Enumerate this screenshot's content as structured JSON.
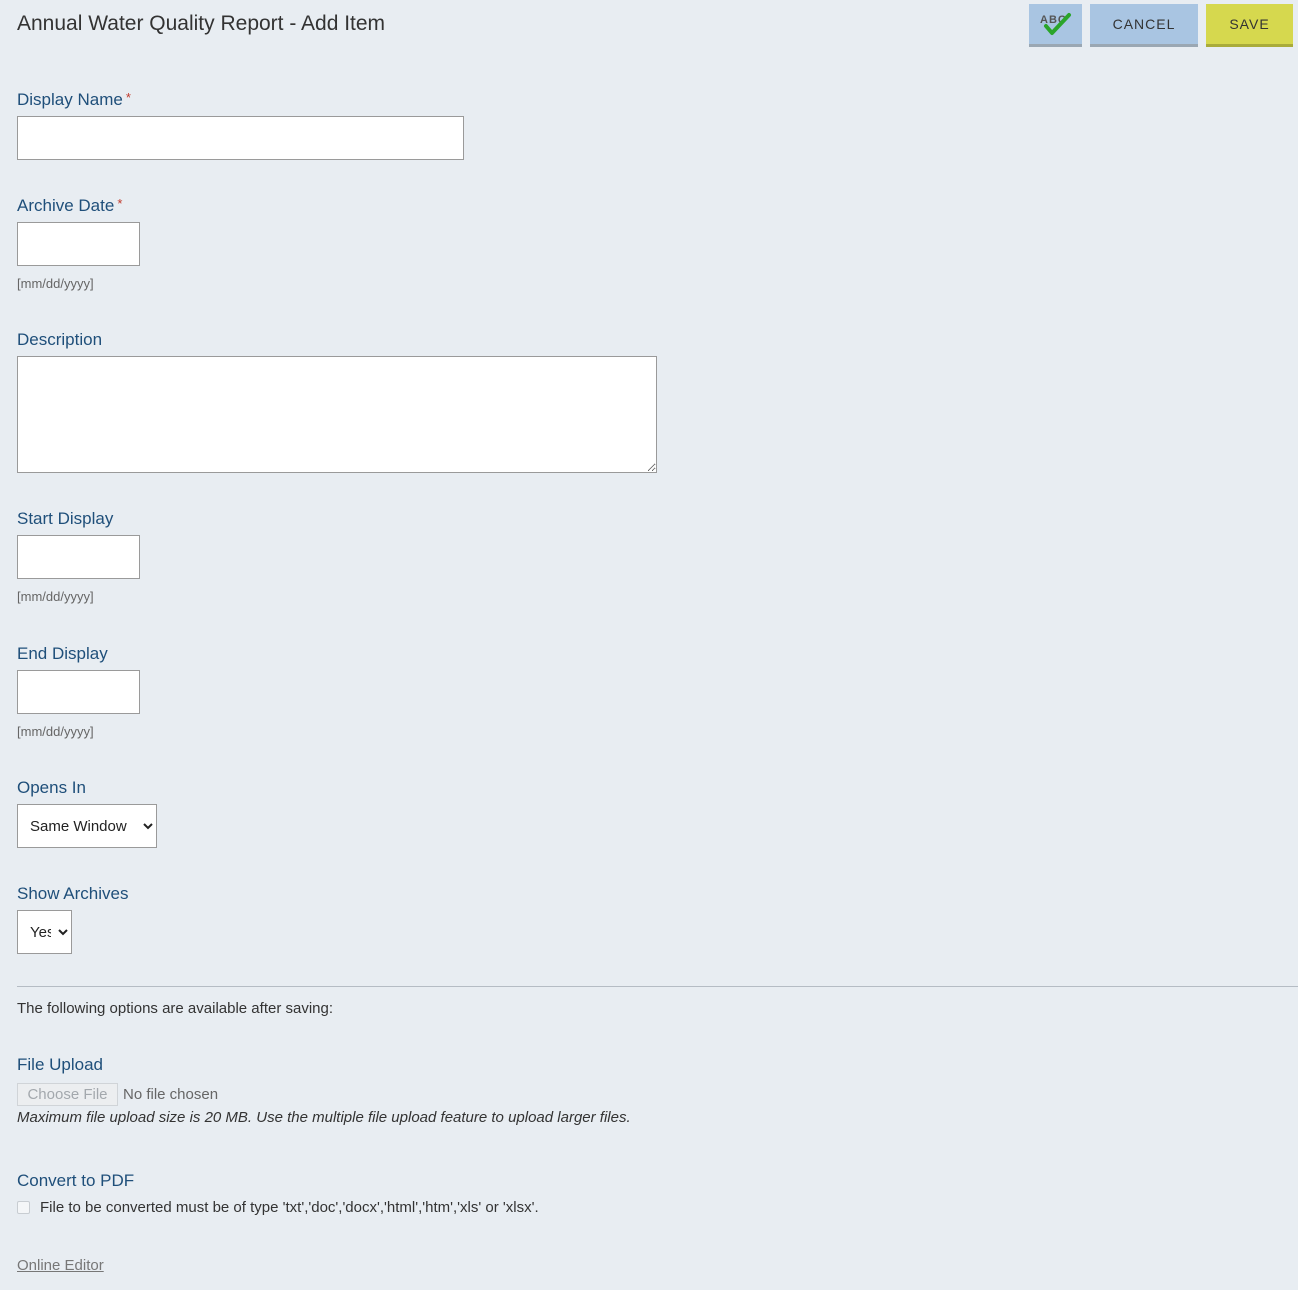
{
  "header": {
    "title": "Annual Water Quality Report - Add Item",
    "spellcheck_text": "ABC",
    "cancel_label": "CANCEL",
    "save_label": "SAVE"
  },
  "form": {
    "display_name": {
      "label": "Display Name",
      "required_mark": "*",
      "value": ""
    },
    "archive_date": {
      "label": "Archive Date",
      "required_mark": "*",
      "value": "",
      "hint": "[mm/dd/yyyy]"
    },
    "description": {
      "label": "Description",
      "value": ""
    },
    "start_display": {
      "label": "Start Display",
      "value": "",
      "hint": "[mm/dd/yyyy]"
    },
    "end_display": {
      "label": "End Display",
      "value": "",
      "hint": "[mm/dd/yyyy]"
    },
    "opens_in": {
      "label": "Opens In",
      "selected": "Same Window"
    },
    "show_archives": {
      "label": "Show Archives",
      "selected": "Yes"
    }
  },
  "after_saving": {
    "note": "The following options are available after saving:",
    "file_upload": {
      "label": "File Upload",
      "button_label": "Choose File",
      "status": "No file chosen",
      "note": "Maximum file upload size is 20 MB. Use the multiple file upload feature to upload larger files."
    },
    "convert_pdf": {
      "label": "Convert to PDF",
      "checkbox_text": "File to be converted must be of type 'txt','doc','docx','html','htm','xls' or 'xlsx'."
    },
    "online_editor_label": "Online Editor"
  },
  "colors": {
    "background": "#e8edf2",
    "label": "#1f4f7a",
    "button_blue": "#a9c5e2",
    "button_save": "#d6d84e",
    "spellcheck_check": "#2aa52a"
  }
}
